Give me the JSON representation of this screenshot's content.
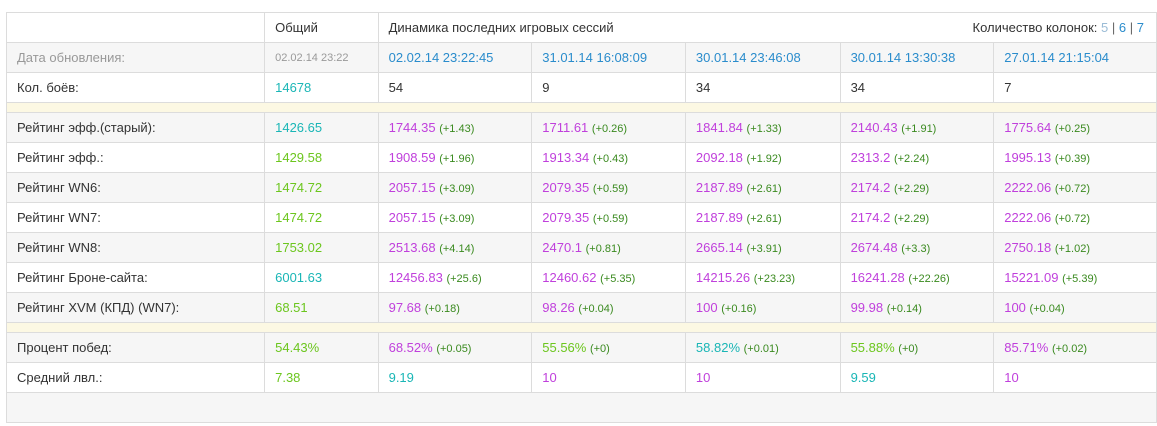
{
  "header": {
    "total": "Общий",
    "dynamics": "Динамика последних игровых сессий",
    "columns_label": "Количество колонок:",
    "column_options": [
      "5",
      "6",
      "7"
    ],
    "sep": "|"
  },
  "update_row": {
    "label": "Дата обновления:",
    "total": "02.02.14 23:22",
    "sessions": [
      "02.02.14 23:22:45",
      "31.01.14 16:08:09",
      "30.01.14 23:46:08",
      "30.01.14 13:30:38",
      "27.01.14 21:15:04"
    ]
  },
  "battles_row": {
    "label": "Кол. боёв:",
    "total": "14678",
    "sessions": [
      "54",
      "9",
      "34",
      "34",
      "7"
    ]
  },
  "ratings": [
    {
      "label": "Рейтинг эфф.(старый):",
      "total": "1426.65",
      "total_color": "teal",
      "sessions": [
        [
          "1744.35",
          "(+1.43)"
        ],
        [
          "1711.61",
          "(+0.26)"
        ],
        [
          "1841.84",
          "(+1.33)"
        ],
        [
          "2140.43",
          "(+1.91)"
        ],
        [
          "1775.64",
          "(+0.25)"
        ]
      ]
    },
    {
      "label": "Рейтинг эфф.:",
      "total": "1429.58",
      "total_color": "green",
      "sessions": [
        [
          "1908.59",
          "(+1.96)"
        ],
        [
          "1913.34",
          "(+0.43)"
        ],
        [
          "2092.18",
          "(+1.92)"
        ],
        [
          "2313.2",
          "(+2.24)"
        ],
        [
          "1995.13",
          "(+0.39)"
        ]
      ]
    },
    {
      "label": "Рейтинг WN6:",
      "total": "1474.72",
      "total_color": "green",
      "sessions": [
        [
          "2057.15",
          "(+3.09)"
        ],
        [
          "2079.35",
          "(+0.59)"
        ],
        [
          "2187.89",
          "(+2.61)"
        ],
        [
          "2174.2",
          "(+2.29)"
        ],
        [
          "2222.06",
          "(+0.72)"
        ]
      ]
    },
    {
      "label": "Рейтинг WN7:",
      "total": "1474.72",
      "total_color": "green",
      "sessions": [
        [
          "2057.15",
          "(+3.09)"
        ],
        [
          "2079.35",
          "(+0.59)"
        ],
        [
          "2187.89",
          "(+2.61)"
        ],
        [
          "2174.2",
          "(+2.29)"
        ],
        [
          "2222.06",
          "(+0.72)"
        ]
      ]
    },
    {
      "label": "Рейтинг WN8:",
      "total": "1753.02",
      "total_color": "green",
      "sessions": [
        [
          "2513.68",
          "(+4.14)"
        ],
        [
          "2470.1",
          "(+0.81)"
        ],
        [
          "2665.14",
          "(+3.91)"
        ],
        [
          "2674.48",
          "(+3.3)"
        ],
        [
          "2750.18",
          "(+1.02)"
        ]
      ]
    },
    {
      "label": "Рейтинг Броне-сайта:",
      "total": "6001.63",
      "total_color": "teal",
      "sessions": [
        [
          "12456.83",
          "(+25.6)"
        ],
        [
          "12460.62",
          "(+5.35)"
        ],
        [
          "14215.26",
          "(+23.23)"
        ],
        [
          "16241.28",
          "(+22.26)"
        ],
        [
          "15221.09",
          "(+5.39)"
        ]
      ]
    },
    {
      "label": "Рейтинг XVM (КПД) (WN7):",
      "total": "68.51",
      "total_color": "green",
      "sessions": [
        [
          "97.68",
          "(+0.18)"
        ],
        [
          "98.26",
          "(+0.04)"
        ],
        [
          "100",
          "(+0.16)"
        ],
        [
          "99.98",
          "(+0.14)"
        ],
        [
          "100",
          "(+0.04)"
        ]
      ]
    }
  ],
  "winrate_row": {
    "label": "Процент побед:",
    "total": "54.43%",
    "total_color": "green",
    "sessions": [
      [
        "68.52%",
        "(+0.05)",
        "purple"
      ],
      [
        "55.56%",
        "(+0)",
        "green"
      ],
      [
        "58.82%",
        "(+0.01)",
        "teal"
      ],
      [
        "55.88%",
        "(+0)",
        "green"
      ],
      [
        "85.71%",
        "(+0.02)",
        "purple"
      ]
    ]
  },
  "level_row": {
    "label": "Средний лвл.:",
    "total": "7.38",
    "total_color": "green",
    "sessions": [
      [
        "9.19",
        "teal"
      ],
      [
        "10",
        "purple"
      ],
      [
        "10",
        "purple"
      ],
      [
        "9.59",
        "teal"
      ],
      [
        "10",
        "purple"
      ]
    ]
  },
  "colors": {
    "teal": "#1ab6b6",
    "green": "#6cc61e",
    "purple": "#c040dc",
    "link": "#2a8ccc",
    "delta": "#3a8a1f"
  }
}
